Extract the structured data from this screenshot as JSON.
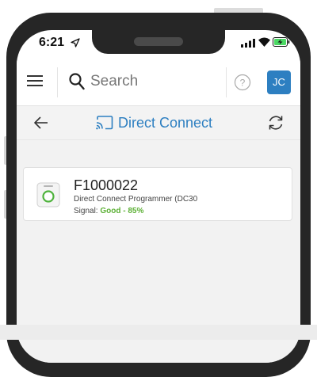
{
  "status_bar": {
    "time": "6:21"
  },
  "app_bar": {
    "search_placeholder": "Search",
    "avatar_initials": "JC"
  },
  "sub_header": {
    "title": "Direct Connect"
  },
  "devices": [
    {
      "name": "F1000022",
      "description": "Direct Connect Programmer (DC30",
      "signal_label": "Signal:",
      "signal_value": "Good - 85%"
    }
  ],
  "colors": {
    "accent": "#2d7fc1",
    "signal_good": "#5cb035",
    "subheader_bg": "#f3f3f3",
    "content_bg": "#f2f2f2"
  }
}
